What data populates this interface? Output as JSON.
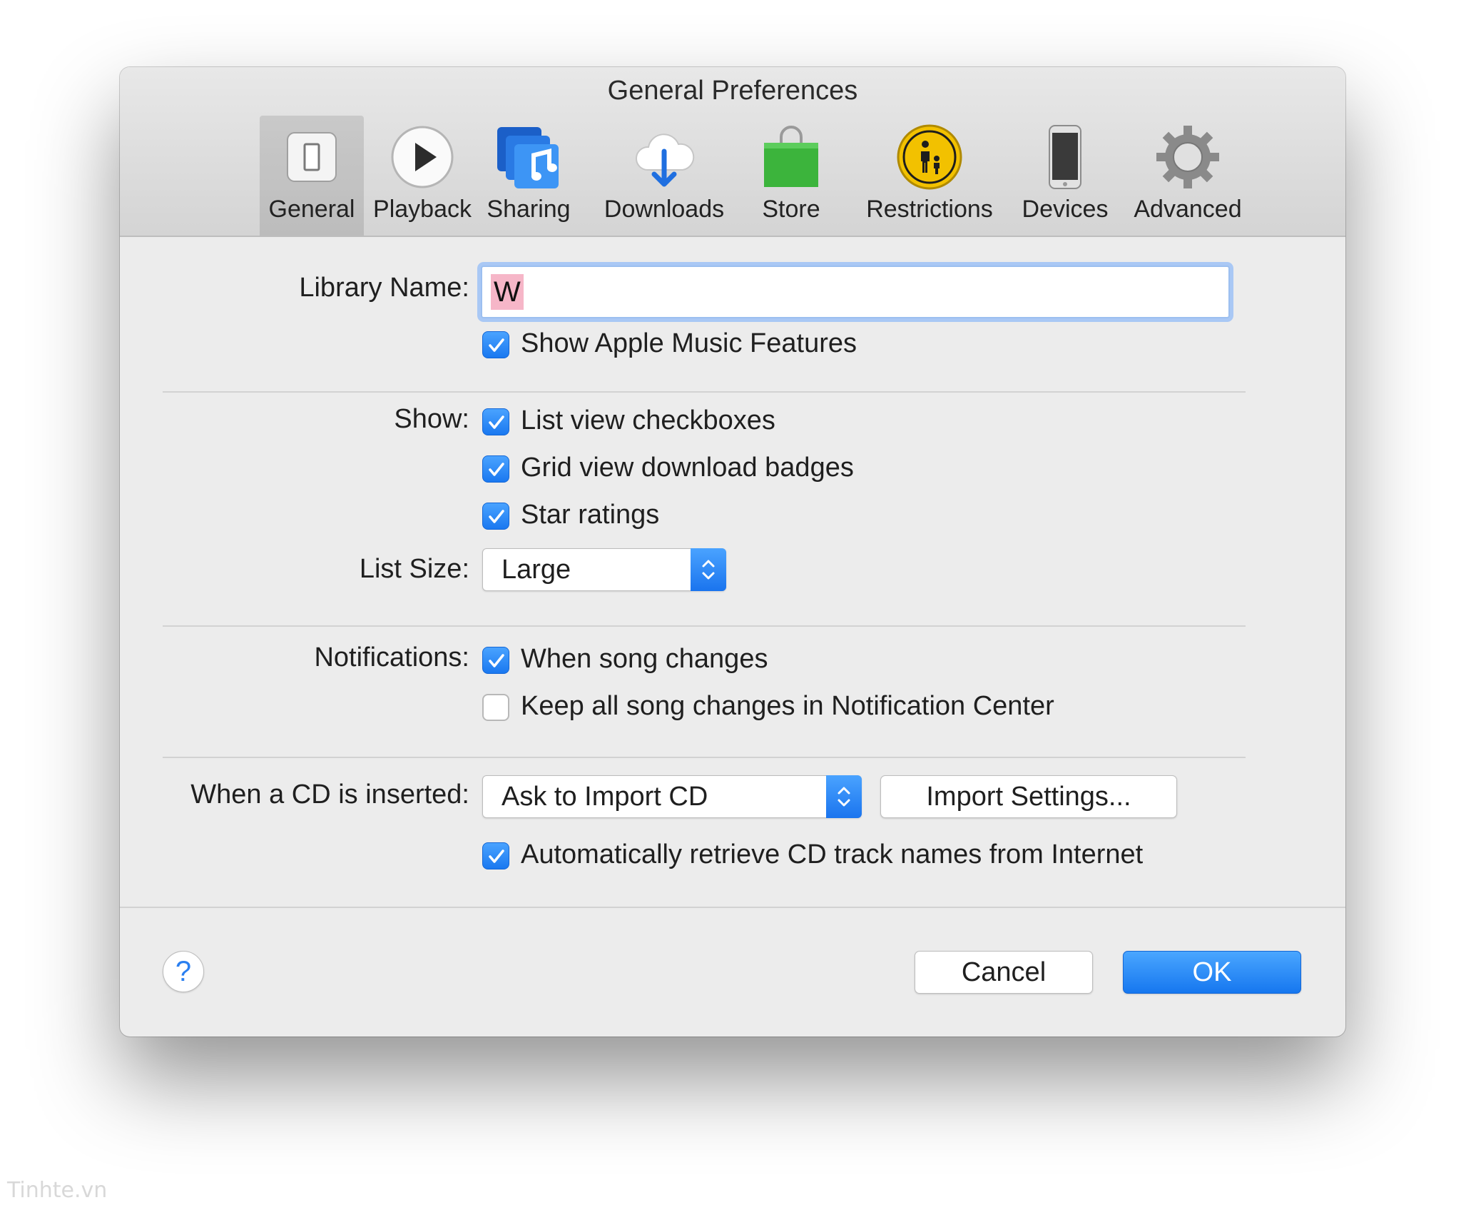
{
  "window": {
    "title": "General Preferences"
  },
  "toolbar": {
    "items": [
      {
        "label": "General",
        "icon": "general-icon",
        "selected": true
      },
      {
        "label": "Playback",
        "icon": "play-icon"
      },
      {
        "label": "Sharing",
        "icon": "music-sharing-icon"
      },
      {
        "label": "Downloads",
        "icon": "cloud-download-icon"
      },
      {
        "label": "Store",
        "icon": "shopping-bag-icon"
      },
      {
        "label": "Restrictions",
        "icon": "parental-restrictions-icon"
      },
      {
        "label": "Devices",
        "icon": "iphone-icon"
      },
      {
        "label": "Advanced",
        "icon": "gear-icon"
      }
    ]
  },
  "library": {
    "label": "Library Name:",
    "value": "W",
    "show_apple_music": {
      "label": "Show Apple Music Features",
      "checked": true
    }
  },
  "show": {
    "label": "Show:",
    "options": [
      {
        "label": "List view checkboxes",
        "checked": true
      },
      {
        "label": "Grid view download badges",
        "checked": true
      },
      {
        "label": "Star ratings",
        "checked": true
      }
    ]
  },
  "list_size": {
    "label": "List Size:",
    "value": "Large"
  },
  "notifications": {
    "label": "Notifications:",
    "options": [
      {
        "label": "When song changes",
        "checked": true
      },
      {
        "label": "Keep all song changes in Notification Center",
        "checked": false
      }
    ]
  },
  "cd": {
    "label": "When a CD is inserted:",
    "action": "Ask to Import CD",
    "import_settings_label": "Import Settings...",
    "auto_retrieve": {
      "label": "Automatically retrieve CD track names from Internet",
      "checked": true
    }
  },
  "footer": {
    "help_label": "?",
    "cancel_label": "Cancel",
    "ok_label": "OK"
  },
  "watermark": "Tinhte.vn",
  "colors": {
    "accent": "#1a78f0",
    "selection_highlight": "#f6b6c8",
    "focus_ring": "#a9c8f5"
  }
}
